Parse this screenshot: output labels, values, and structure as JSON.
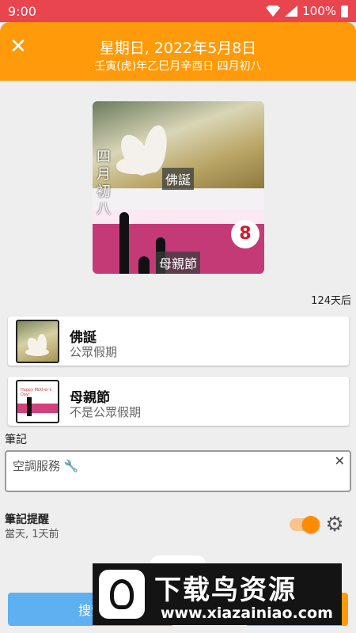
{
  "status_bar": {
    "time": "9:00",
    "network": "LTE",
    "battery": "100%"
  },
  "header": {
    "title": "星期日, 2022年5月8日",
    "subtitle": "壬寅(虎)年乙巳月辛酉日 四月初八"
  },
  "hero": {
    "lunar_vertical": "四月初八",
    "tag_top": "佛誕",
    "tag_bottom": "母親節",
    "day_number": "8"
  },
  "days_left": "124天后",
  "holidays": [
    {
      "name": "佛誕",
      "type": "公眾假期",
      "thumb": "lotus"
    },
    {
      "name": "母親節",
      "type": "不是公眾假期",
      "thumb": "mothers-day",
      "thumb_text": "Happy Mother's Day!"
    }
  ],
  "notes": {
    "label": "筆記",
    "value": "空調服務 🔧",
    "clear_glyph": "✕"
  },
  "reminder": {
    "title": "筆記提醒",
    "subtitle": "當天, 1天前",
    "enabled": true
  },
  "buttons": {
    "search_label": "搜索",
    "save_label": ""
  },
  "watermark": {
    "text_cn": "下载鸟资源",
    "url": "www.xiazainiao.com"
  },
  "colors": {
    "status_bar": "#e8454f",
    "header": "#ff9a0a",
    "toggle": "#ff8c00",
    "search_button": "#5eb0f0",
    "day_number": "#d41a2a"
  }
}
